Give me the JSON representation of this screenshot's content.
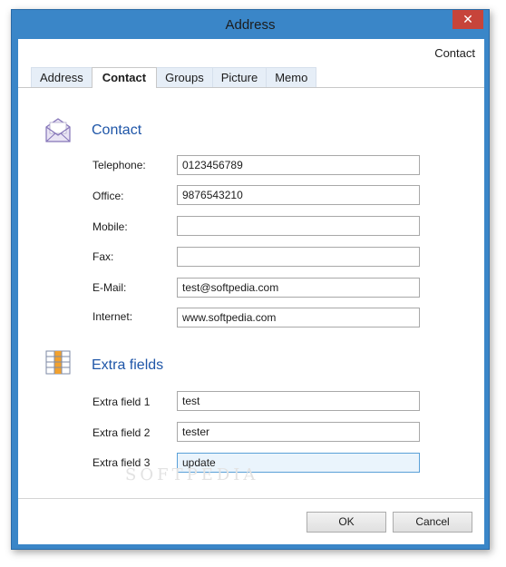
{
  "window": {
    "title": "Address",
    "close_glyph": "✕"
  },
  "header": {
    "label": "Contact"
  },
  "tabs": [
    {
      "label": "Address",
      "active": false
    },
    {
      "label": "Contact",
      "active": true
    },
    {
      "label": "Groups",
      "active": false
    },
    {
      "label": "Picture",
      "active": false
    },
    {
      "label": "Memo",
      "active": false
    }
  ],
  "contact": {
    "title": "Contact",
    "icon": "envelope-icon",
    "fields": [
      {
        "label": "Telephone:",
        "value": "0123456789"
      },
      {
        "label": "Office:",
        "value": "9876543210"
      },
      {
        "label": "Mobile:",
        "value": ""
      },
      {
        "label": "Fax:",
        "value": ""
      },
      {
        "label": "E-Mail:",
        "value": "test@softpedia.com"
      },
      {
        "label": "Internet:",
        "value": "www.softpedia.com"
      }
    ]
  },
  "extra": {
    "title": "Extra fields",
    "icon": "grid-columns-icon",
    "fields": [
      {
        "label": "Extra field 1",
        "value": "test"
      },
      {
        "label": "Extra field 2",
        "value": "tester"
      },
      {
        "label": "Extra field 3",
        "value": "update"
      }
    ]
  },
  "buttons": {
    "ok": "OK",
    "cancel": "Cancel"
  },
  "watermark": {
    "text": "SOFTPEDIA",
    "url": "www.softpedia.com"
  },
  "colors": {
    "accent": "#1f56a8",
    "frame": "#3a86c8",
    "close": "#c7443a",
    "focus": "#5aa0d8"
  }
}
